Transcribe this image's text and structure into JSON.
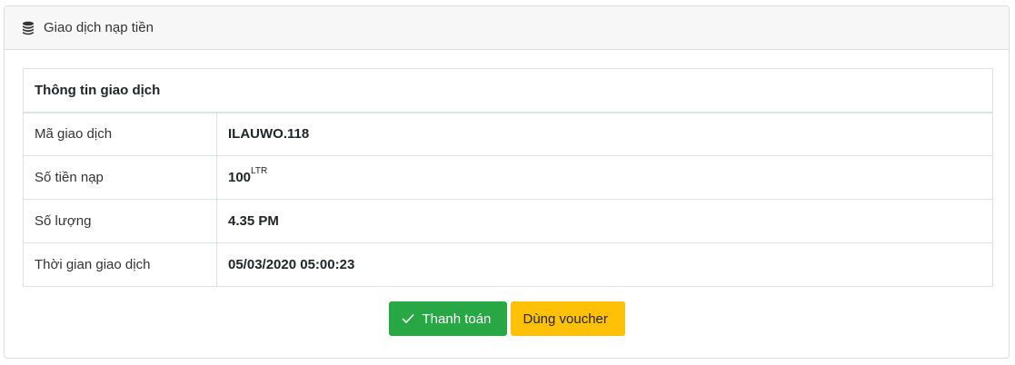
{
  "panel": {
    "title": "Giao dịch nạp tiền",
    "icon": "coins-icon"
  },
  "table": {
    "header": "Thông tin giao dịch",
    "rows": [
      {
        "label": "Mã giao dịch",
        "value": "ILAUWO.118"
      },
      {
        "label": "Số tiền nạp",
        "value": "100",
        "unit": "LTR"
      },
      {
        "label": "Số lượng",
        "value": "4.35 PM"
      },
      {
        "label": "Thời gian giao dịch",
        "value": "05/03/2020 05:00:23"
      }
    ]
  },
  "actions": {
    "pay_label": "Thanh toán",
    "pay_icon": "check-icon",
    "voucher_label": "Dùng voucher"
  },
  "colors": {
    "success": "#28a745",
    "warning": "#ffc107",
    "header_bg": "#f7f7f7"
  }
}
